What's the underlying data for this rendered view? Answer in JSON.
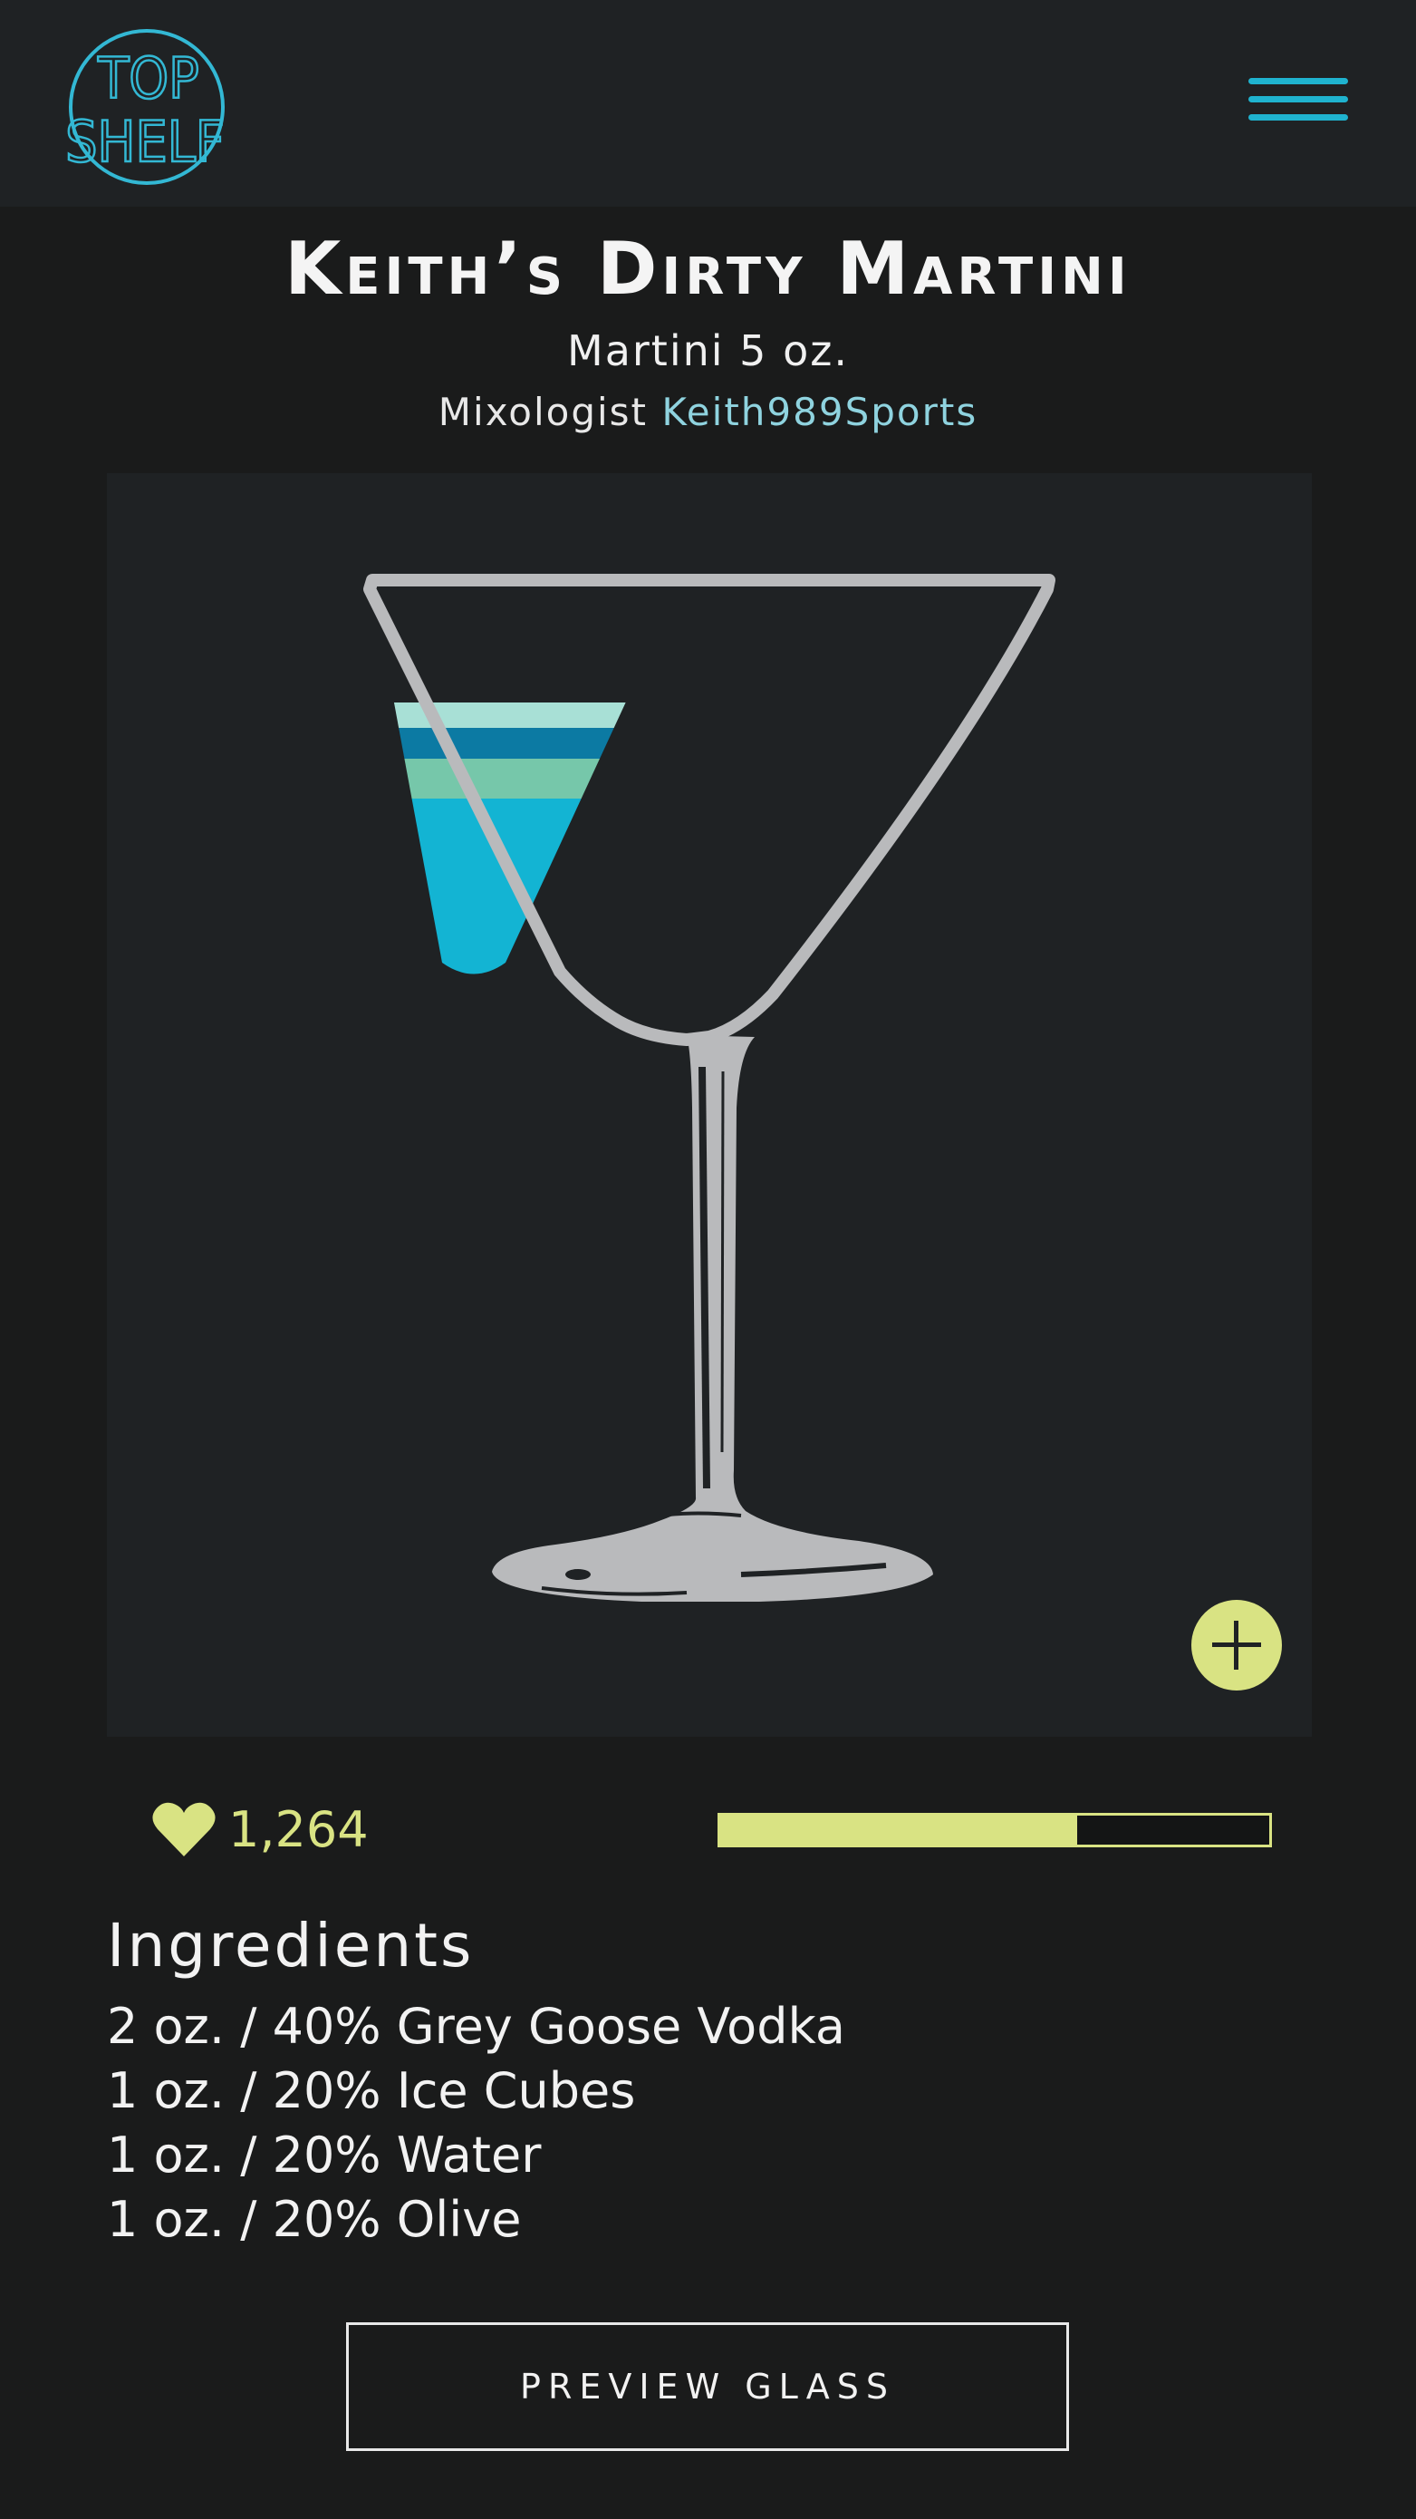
{
  "header": {
    "logo_text": "TOP SHELF",
    "menu_icon": "hamburger-menu-icon"
  },
  "drink": {
    "title": "Keith’s Dirty Martini",
    "subtitle": "Martini 5 oz.",
    "mixologist_label": "Mixologist",
    "mixologist_name": "Keith989Sports"
  },
  "glass": {
    "type": "martini",
    "layers": [
      "#a8e0d6",
      "#0c7aa3",
      "#76c7aa",
      "#13b4d3"
    ]
  },
  "actions": {
    "add_icon": "plus-icon",
    "heart_icon": "heart-icon"
  },
  "stats": {
    "likes": "1,264",
    "rating_fraction": 0.65
  },
  "ingredients": {
    "heading": "Ingredients",
    "items": [
      "2 oz. / 40% Grey Goose Vodka",
      "1 oz. / 20% Ice Cubes",
      "1 oz. / 20% Water",
      "1 oz. / 20% Olive"
    ]
  },
  "preview_button": "PREVIEW GLASS",
  "colors": {
    "accent_cyan": "#1fb3cf",
    "accent_lime": "#d9e383",
    "background": "#1a1b1b",
    "panel": "#1f2224"
  }
}
